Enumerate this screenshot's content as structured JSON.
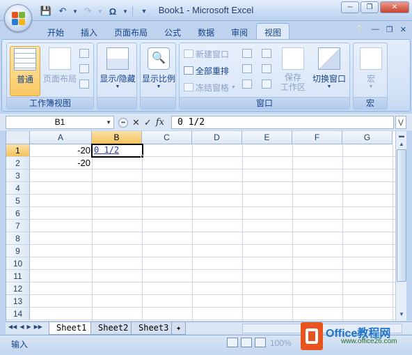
{
  "window": {
    "title": "Book1 - Microsoft Excel"
  },
  "tabs": [
    "开始",
    "插入",
    "页面布局",
    "公式",
    "数据",
    "审阅",
    "视图"
  ],
  "active_tab": "视图",
  "ribbon": {
    "workbook_views": {
      "label": "工作簿视图",
      "normal": "普通",
      "page_layout": "页面布局"
    },
    "show_hide": {
      "label": "显示/隐藏"
    },
    "zoom": {
      "label": "显示比例"
    },
    "window": {
      "label": "窗口",
      "new_window": "新建窗口",
      "arrange_all": "全部重排",
      "freeze_panes": "冻结窗格",
      "save_workspace": "保存\n工作区",
      "save_workspace_l1": "保存",
      "save_workspace_l2": "工作区",
      "switch_windows": "切换窗口"
    },
    "macros": {
      "label": "宏",
      "button": "宏"
    }
  },
  "formula_bar": {
    "name_box": "B1",
    "fx": "fx",
    "content": "0 1/2"
  },
  "grid": {
    "columns": [
      "A",
      "B",
      "C",
      "D",
      "E",
      "F",
      "G"
    ],
    "rows": [
      "1",
      "2",
      "3",
      "4",
      "5",
      "6",
      "7",
      "8",
      "9",
      "10",
      "11",
      "12",
      "13",
      "14"
    ],
    "cells": {
      "A1": "-20",
      "A2": "-20",
      "B1": "0 1/2"
    },
    "active_cell": "B1"
  },
  "sheets": [
    "Sheet1",
    "Sheet2",
    "Sheet3"
  ],
  "active_sheet": "Sheet1",
  "status": {
    "mode": "输入",
    "zoom": "100%"
  },
  "watermark": {
    "brand": "Office教程网",
    "url": "www.office26.com"
  }
}
